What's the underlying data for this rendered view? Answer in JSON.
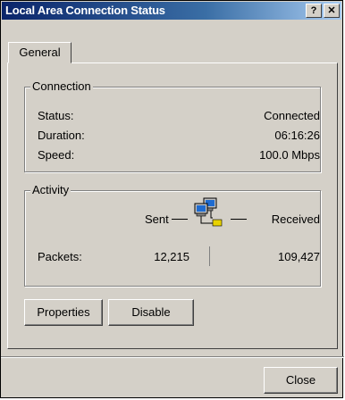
{
  "window": {
    "title": "Local Area Connection Status",
    "help_label": "?",
    "close_glyph": "✕"
  },
  "tabs": [
    {
      "label": "General",
      "active": true
    }
  ],
  "connection": {
    "group_label": "Connection",
    "rows": [
      {
        "label": "Status:",
        "value": "Connected"
      },
      {
        "label": "Duration:",
        "value": "06:16:26"
      },
      {
        "label": "Speed:",
        "value": "100.0 Mbps"
      }
    ]
  },
  "activity": {
    "group_label": "Activity",
    "sent_label": "Sent",
    "received_label": "Received",
    "packets_label": "Packets:",
    "packets_sent": "12,215",
    "packets_received": "109,427"
  },
  "buttons": {
    "properties": "Properties",
    "disable": "Disable",
    "close": "Close"
  },
  "colors": {
    "face": "#d4d0c8",
    "title_start": "#0a246a",
    "title_end": "#a6caf0"
  }
}
